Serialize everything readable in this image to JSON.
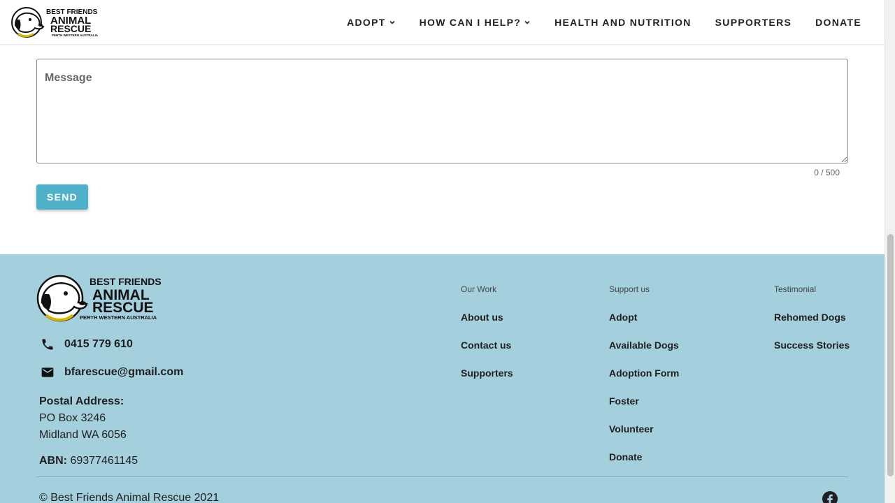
{
  "header": {
    "logo_lines": [
      "BEST FRIENDS",
      "ANIMAL",
      "RESCUE",
      "PERTH WESTERN AUSTRALIA"
    ],
    "nav": [
      {
        "label": "ADOPT",
        "has_dropdown": true
      },
      {
        "label": "HOW CAN I HELP?",
        "has_dropdown": true
      },
      {
        "label": "HEALTH AND NUTRITION",
        "has_dropdown": false
      },
      {
        "label": "SUPPORTERS",
        "has_dropdown": false
      },
      {
        "label": "DONATE",
        "has_dropdown": false
      }
    ]
  },
  "form": {
    "message_placeholder": "Message",
    "message_value": "",
    "counter": "0 / 500",
    "send_label": "SEND",
    "accent_color": "#4eb1c8"
  },
  "footer": {
    "background_color": "#a4d0dd",
    "logo_lines": [
      "BEST FRIENDS",
      "ANIMAL",
      "RESCUE",
      "PERTH WESTERN AUSTRALIA"
    ],
    "phone": "0415 779 610",
    "email": "bfarescue@gmail.com",
    "postal_label": "Postal Address:",
    "postal_line1": "PO Box 3246",
    "postal_line2": "Midland WA 6056",
    "abn_label": "ABN:",
    "abn_value": "69377461145",
    "columns": [
      {
        "title": "Our Work",
        "links": [
          "About us",
          "Contact us",
          "Supporters"
        ]
      },
      {
        "title": "Support us",
        "links": [
          "Adopt",
          "Available Dogs",
          "Adoption Form",
          "Foster",
          "Volunteer",
          "Donate"
        ]
      },
      {
        "title": "Testimonial",
        "links": [
          "Rehomed Dogs",
          "Success Stories"
        ]
      }
    ],
    "copyright": "© Best Friends Animal Rescue 2021",
    "social_icon": "facebook-icon"
  }
}
